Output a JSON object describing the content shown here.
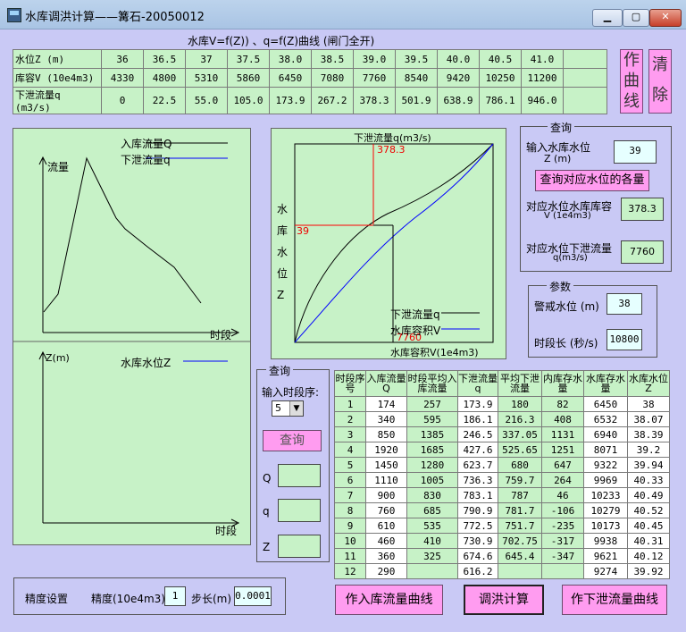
{
  "window": {
    "title": "水库调洪计算——篝石-20050012",
    "min": "▁",
    "max": "▢",
    "close": "✕"
  },
  "top_table": {
    "caption": "水库V=f(Z))  、q=f(Z)曲线 (闸门全开)",
    "rows": [
      {
        "label": "水位Z (m)",
        "values": [
          "36",
          "36.5",
          "37",
          "37.5",
          "38.0",
          "38.5",
          "39.0",
          "39.5",
          "40.0",
          "40.5",
          "41.0",
          ""
        ]
      },
      {
        "label": "库容V (10e4m3)",
        "values": [
          "4330",
          "4800",
          "5310",
          "5860",
          "6450",
          "7080",
          "7760",
          "8540",
          "9420",
          "10250",
          "11200",
          ""
        ]
      },
      {
        "label": "下泄流量q (m3/s)",
        "values": [
          "0",
          "22.5",
          "55.0",
          "105.0",
          "173.9",
          "267.2",
          "378.3",
          "501.9",
          "638.9",
          "786.1",
          "946.0",
          ""
        ]
      }
    ]
  },
  "buttons": {
    "draw_curve": [
      "作",
      "曲",
      "线"
    ],
    "clear": [
      "清",
      "除"
    ],
    "query_level": "查询对应水位的各量",
    "query_step": "查询",
    "draw_inflow": "作入库流量曲线",
    "routing": "调洪计算",
    "draw_outflow": "作下泄流量曲线"
  },
  "chart_inflow": {
    "legend": [
      "入库流量Q",
      "下泄流量q"
    ],
    "ylabel": "流量",
    "xlabel": "时段",
    "legend_colors": [
      "#000000",
      "#0000ff"
    ]
  },
  "chart_level": {
    "legend": [
      "水库水位Z"
    ],
    "ylabel": "Z(m)",
    "xlabel": "时段",
    "legend_colors": [
      "#0000ff"
    ]
  },
  "chart_curve": {
    "title": "下泄流量q(m3/s)",
    "ylabel_chars": [
      "水",
      "库",
      "水",
      "位",
      "Z"
    ],
    "xlabel": "水库容积V(1e4m3)",
    "mark_q": "378.3",
    "mark_z": "39",
    "mark_v": "7760",
    "legend": [
      "下泄流量q",
      "水库容积V"
    ],
    "legend_colors": [
      "#000000",
      "#0000ff"
    ]
  },
  "query_panel": {
    "title": "查询",
    "input_label": "输入水库水位",
    "input_unit": "Z (m)",
    "input_value": "39",
    "storage_label": "对应水位水库库容",
    "storage_unit": "V (1e4m3)",
    "storage_value": "378.3",
    "outflow_label": "对应水位下泄流量",
    "outflow_unit": "q(m3/s)",
    "outflow_value": "7760"
  },
  "params_panel": {
    "title": "参数",
    "warn_label": "警戒水位 (m)",
    "warn_value": "38",
    "step_label": "时段长 (秒/s)",
    "step_value": "10800"
  },
  "step_query": {
    "title": "查询",
    "label": "输入时段序:",
    "selected": "5",
    "q_label": "Q",
    "q2_label": "q",
    "z_label": "Z"
  },
  "result_table": {
    "headers": [
      "时段序号",
      "入库流量Q",
      "时段平均入库流量",
      "下泄流量q",
      "平均下泄流量",
      "内库存水量",
      "水库存水量",
      "水库水位Z"
    ],
    "seq": [
      "1",
      "2",
      "3",
      "4",
      "5",
      "6",
      "7",
      "8",
      "9",
      "10",
      "11",
      "12"
    ],
    "inflow": [
      "174",
      "340",
      "850",
      "1920",
      "1450",
      "1110",
      "900",
      "760",
      "610",
      "460",
      "360",
      "290"
    ],
    "avg_inflow": [
      "257",
      "595",
      "1385",
      "1685",
      "1280",
      "1005",
      "830",
      "685",
      "535",
      "410",
      "325"
    ],
    "outflow": [
      "173.9",
      "186.1",
      "246.5",
      "427.6",
      "623.7",
      "736.3",
      "783.1",
      "790.9",
      "772.5",
      "730.9",
      "674.6",
      "616.2"
    ],
    "avg_outflow": [
      "180",
      "216.3",
      "337.05",
      "525.65",
      "680",
      "759.7",
      "787",
      "781.7",
      "751.7",
      "702.75",
      "645.4"
    ],
    "storage_change": [
      "82",
      "408",
      "1131",
      "1251",
      "647",
      "264",
      "46",
      "-106",
      "-235",
      "-317",
      "-347"
    ],
    "storage": [
      "6450",
      "6532",
      "6940",
      "8071",
      "9322",
      "9969",
      "10233",
      "10279",
      "10173",
      "9938",
      "9621",
      "9274"
    ],
    "level": [
      "38",
      "38.07",
      "38.39",
      "39.2",
      "39.94",
      "40.33",
      "40.49",
      "40.52",
      "40.45",
      "40.31",
      "40.12",
      "39.92"
    ]
  },
  "precision": {
    "title": "精度设置",
    "acc_label": "精度(10e4m3)",
    "acc_value": "1",
    "step_label": "步长(m)",
    "step_value": "0.0001"
  }
}
